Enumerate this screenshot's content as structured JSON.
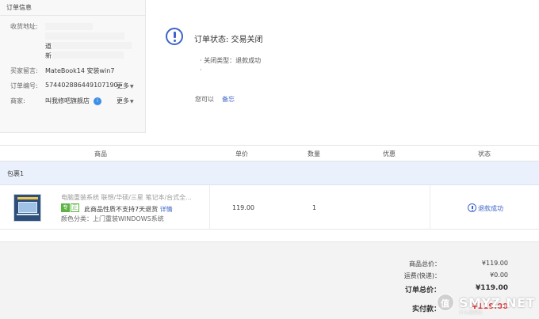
{
  "order_info": {
    "title": "订单信息",
    "address_label": "收货地址:",
    "address_lines": [
      "",
      "",
      "道",
      "新"
    ],
    "buyer_message_label": "买家留言:",
    "buyer_message": "MateBook14 安装win7",
    "order_no_label": "订单编号:",
    "order_no": "574402886449107190",
    "merchant_label": "商家:",
    "merchant": "叫我修吧旗舰店",
    "more_label": "更多"
  },
  "status": {
    "title": "订单状态: 交易关闭",
    "close_type": "关闭类型：退款成功",
    "bullet2": "",
    "you_can": "您可以",
    "memo": "备忘"
  },
  "table": {
    "headers": {
      "product": "商品",
      "unit_price": "单价",
      "quantity": "数量",
      "discount": "优惠",
      "state": "状态"
    },
    "package_label": "包裹1",
    "items": [
      {
        "title": "电脑重装系统 联想/华硕/三星 笔记本/台式全...",
        "tag_a": "专",
        "tag_b": "正",
        "note": "此商品性质不支持7天退货",
        "detail": "详情",
        "spec": "颜色分类：上门重装WINDOWS系统",
        "price": "119.00",
        "qty": "1",
        "state": "退款成功"
      }
    ]
  },
  "totals": {
    "goods_total_label": "商品总价：",
    "goods_total": "¥119.00",
    "shipping_label": "运费(快递)：",
    "shipping": "¥0.00",
    "order_total_label": "订单总价：",
    "order_total": "¥119.00",
    "paid_label": "实付款：",
    "paid": "¥119.00"
  },
  "watermark": {
    "badge": "值",
    "site": "SMYZ.NET",
    "sub": "什么值得买"
  },
  "colors": {
    "accent_blue": "#3c63c9",
    "pay_red": "#e4393c",
    "package_bg": "#eaf1fd",
    "tag_green": "#5bb341"
  }
}
